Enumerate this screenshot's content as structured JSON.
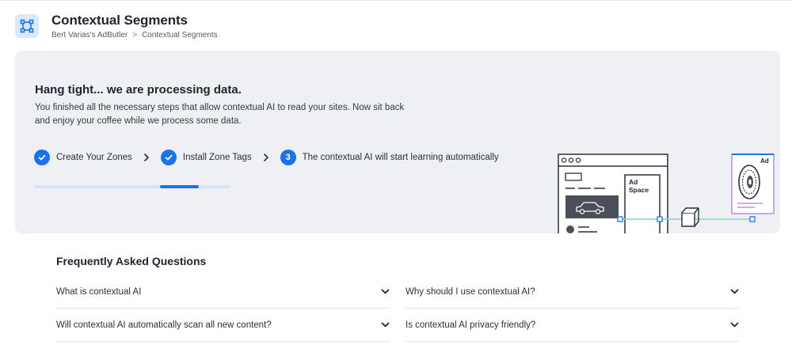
{
  "header": {
    "title": "Contextual Segments",
    "icon": "segments-icon",
    "breadcrumb": [
      "Bert Varias's AdButler",
      "Contextual Segments"
    ],
    "breadcrumb_separator": ">"
  },
  "status_card": {
    "title": "Hang tight... we are processing data.",
    "description": "You finished all the necessary steps that allow contextual AI to read your sites. Now sit back and enjoy your coffee while we process some data.",
    "steps": [
      {
        "label": "Create Your Zones",
        "state": "done",
        "marker": ""
      },
      {
        "label": "Install Zone Tags",
        "state": "done",
        "marker": ""
      },
      {
        "label": "The contextual AI will start learning automatically",
        "state": "current",
        "marker": "3"
      }
    ],
    "progress": {
      "indeterminate_segment_start": 0.64,
      "indeterminate_segment_end": 0.84
    },
    "illustration": {
      "ad_space_label_1": "Ad",
      "ad_space_label_2": "Space",
      "ad_badge": "Ad"
    }
  },
  "faq": {
    "title": "Frequently Asked Questions",
    "items": [
      {
        "question": "What is contextual AI"
      },
      {
        "question": "Why should I use contextual AI?"
      },
      {
        "question": "Will contextual AI automatically scan all new content?"
      },
      {
        "question": "Is contextual AI privacy friendly?"
      }
    ]
  },
  "colors": {
    "accent": "#1a73e8",
    "card_bg": "#eef0f3",
    "icon_bg": "#d9e8fb",
    "progress_track": "#d5e4f7"
  }
}
